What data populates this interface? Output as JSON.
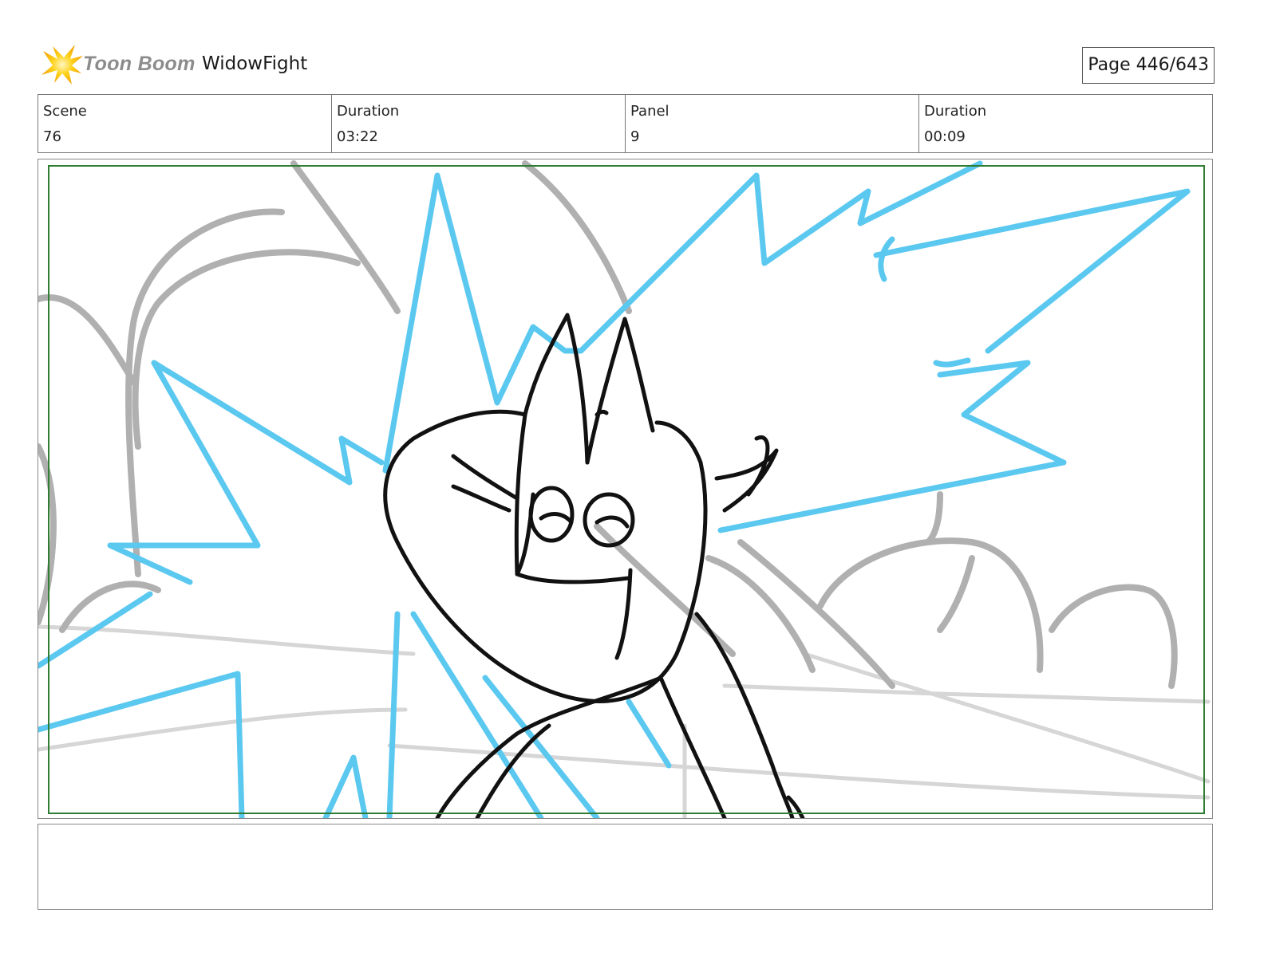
{
  "header": {
    "brand": "Toon Boom",
    "brand_icon": "star-burst-logo",
    "project_title": "WidowFight",
    "page_indicator": "Page 446/643"
  },
  "info": {
    "scene_label": "Scene",
    "scene_value": "76",
    "scene_duration_label": "Duration",
    "scene_duration_value": "03:22",
    "panel_label": "Panel",
    "panel_value": "9",
    "panel_duration_label": "Duration",
    "panel_duration_value": "00:09"
  },
  "panel": {
    "illustration": "storyboard sketch",
    "colors": {
      "effects": "#5bc8f0",
      "background": "#b0b0b0",
      "ground": "#d6d6d6",
      "character": "#111111",
      "safe_area": "#2e7d32"
    }
  },
  "caption": {
    "text": ""
  }
}
